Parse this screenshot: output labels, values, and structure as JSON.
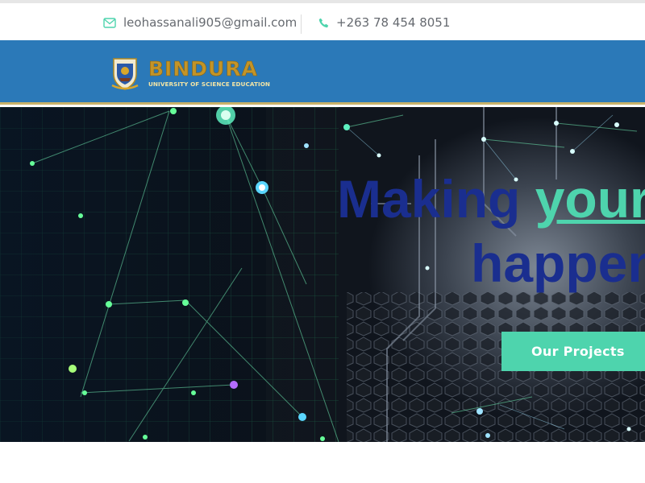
{
  "topbar": {
    "email": "leohassanali905@gmail.com",
    "phone": "+263 78 454 8051",
    "email_icon": "envelope-icon",
    "phone_icon": "phone-icon"
  },
  "header": {
    "logo_title": "BINDURA",
    "logo_subtitle": "UNIVERSITY OF SCIENCE EDUCATION"
  },
  "hero": {
    "heading_part1": "Making ",
    "heading_highlight": "your",
    "heading_line2": "happen",
    "cta_label": "Our Projects"
  },
  "colors": {
    "nav_blue": "#2b79b8",
    "accent_green": "#4ed4ad",
    "heading_blue": "#1a2e8f",
    "logo_gold": "#c39428"
  }
}
